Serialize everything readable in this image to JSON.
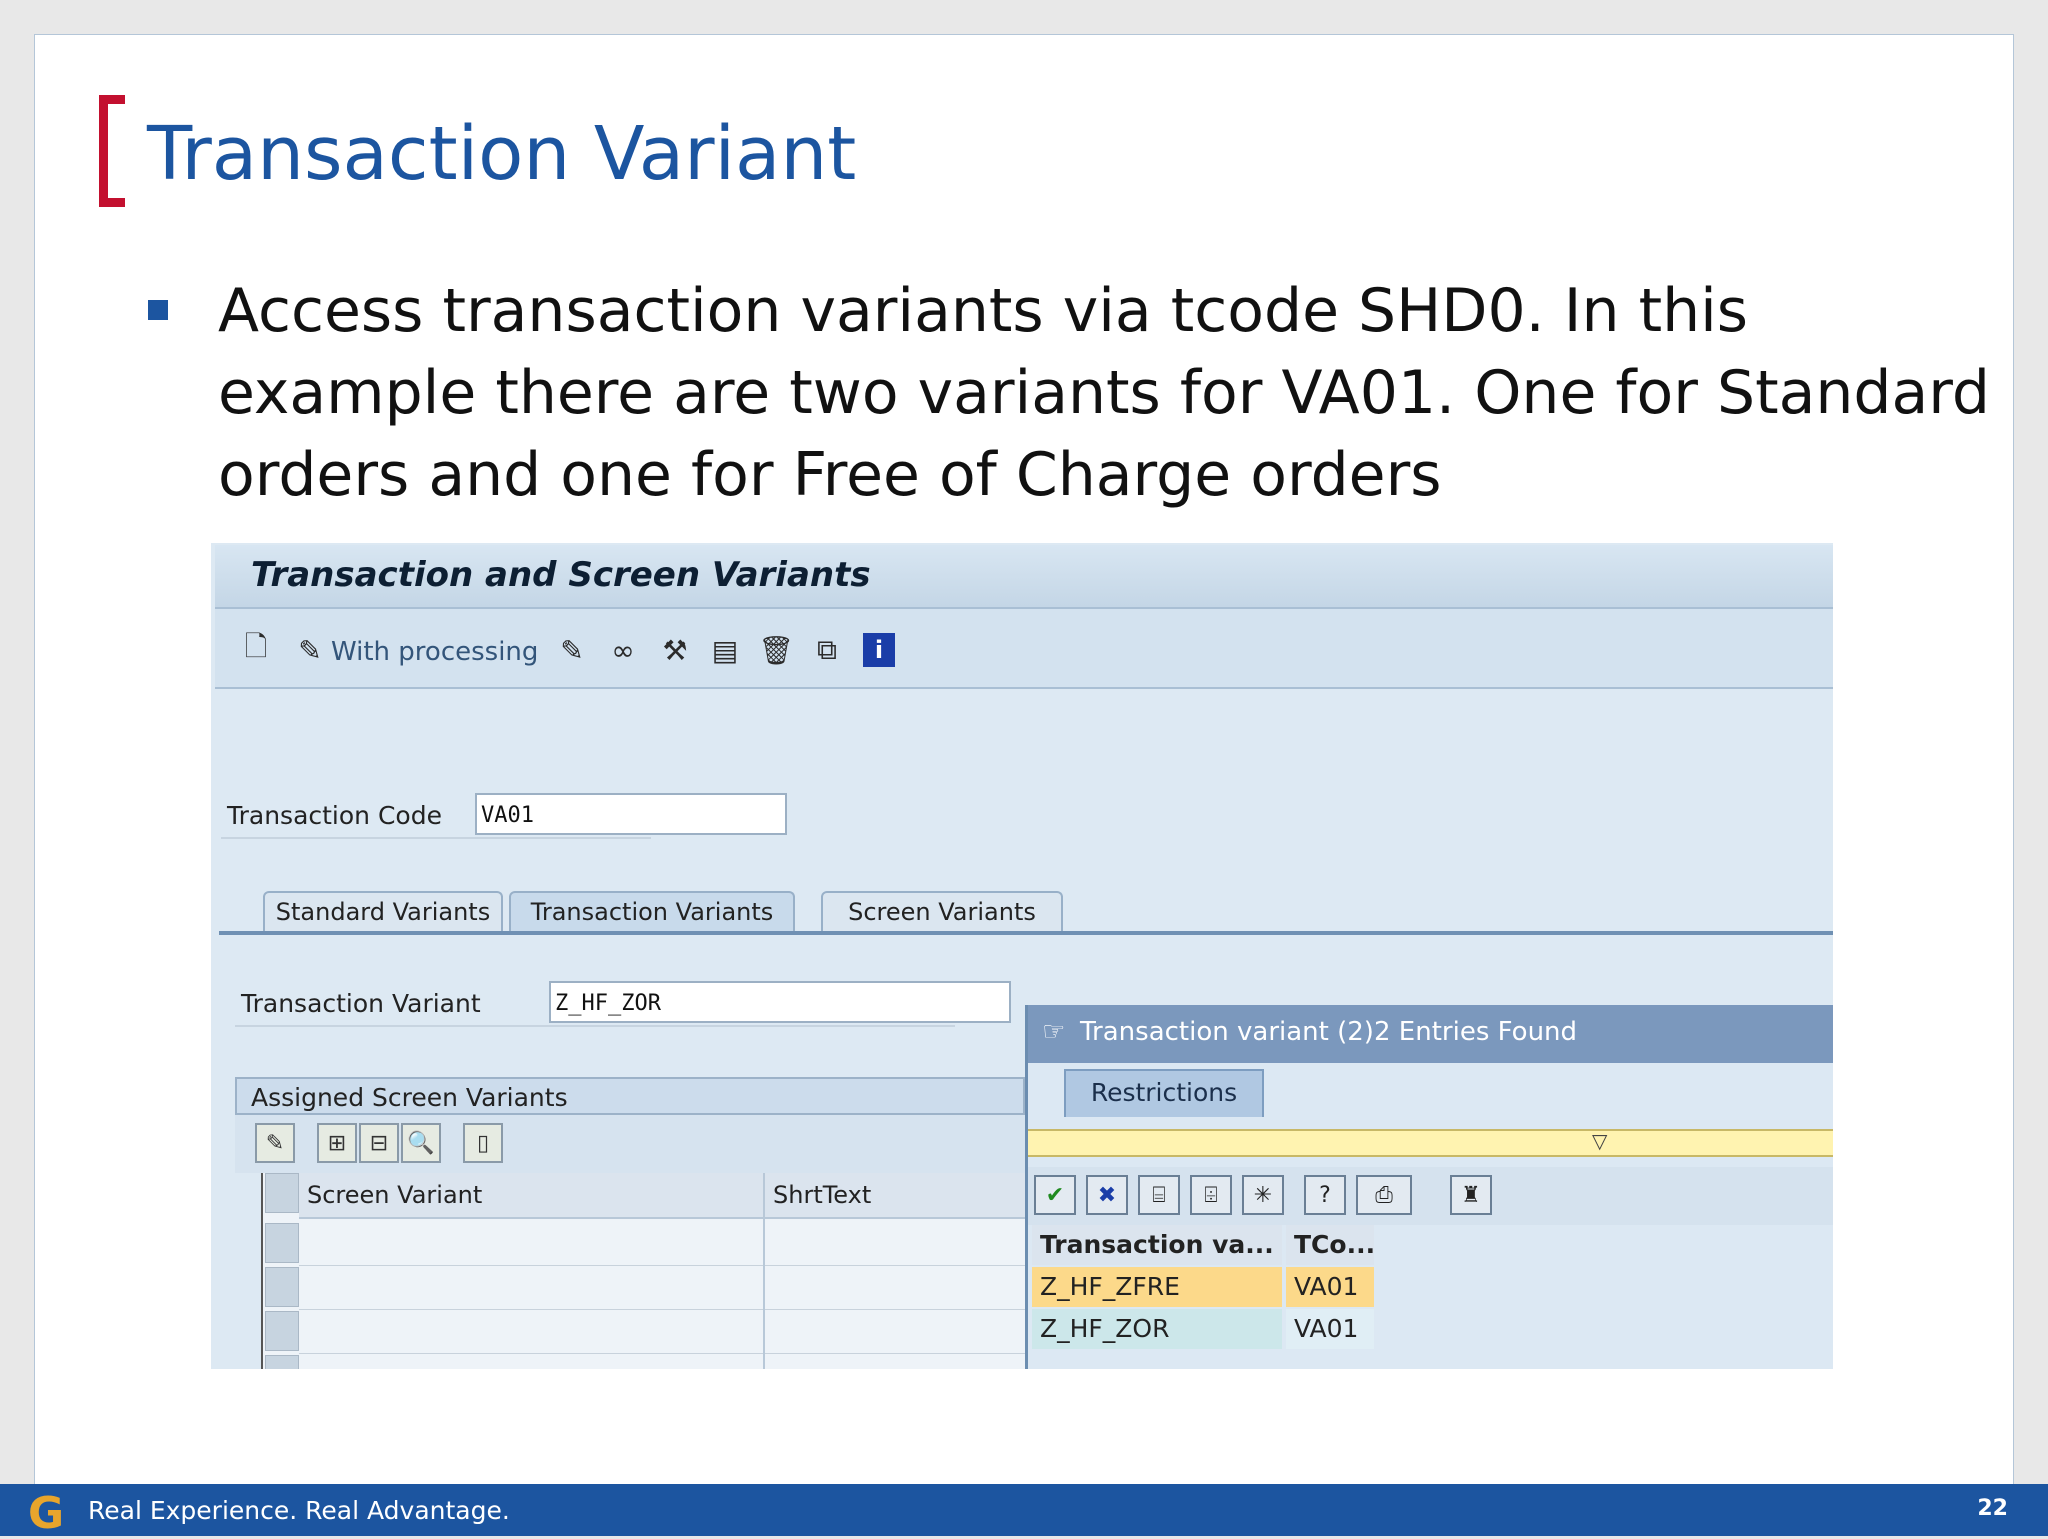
{
  "slide": {
    "title": "Transaction Variant",
    "bullet": "Access transaction variants via tcode SHD0.  In this example there are two variants for VA01.  One for Standard orders and one for Free of Charge orders",
    "footer_tagline": "Real Experience. Real Advantage.",
    "logo_letter": "G",
    "page_number": "22",
    "colors": {
      "title": "#1c55a0",
      "bracket": "#c3102f",
      "footer": "#1c55a0",
      "logo": "#e8a52c"
    }
  },
  "sap": {
    "window_title": "Transaction and Screen Variants",
    "toolbar": {
      "create_icon": "document-icon",
      "with_processing_label": "With processing",
      "icons": [
        "pencil-icon",
        "glasses-icon",
        "hierarchy-icon",
        "screen-icon",
        "trash-icon",
        "copy-icon",
        "info-icon"
      ]
    },
    "transaction_code_label": "Transaction Code",
    "transaction_code_value": "VA01",
    "tabs": [
      "Standard Variants",
      "Transaction Variants",
      "Screen Variants"
    ],
    "active_tab": "Transaction Variants",
    "transaction_variant_label": "Transaction Variant",
    "transaction_variant_value": "Z_HF_ZOR",
    "assigned_header": "Assigned Screen Variants",
    "table_columns": [
      "Screen Variant",
      "ShrtText"
    ],
    "popup": {
      "title": "Transaction variant (2)",
      "entries": "2 Entries Found",
      "restrictions_tab": "Restrictions",
      "columns": [
        "Transaction va...",
        "TCo..."
      ],
      "rows": [
        {
          "variant": "Z_HF_ZFRE",
          "tcode": "VA01",
          "highlight": "#fcd98a"
        },
        {
          "variant": "Z_HF_ZOR",
          "tcode": "VA01",
          "highlight": "#cce7ea"
        }
      ]
    }
  }
}
